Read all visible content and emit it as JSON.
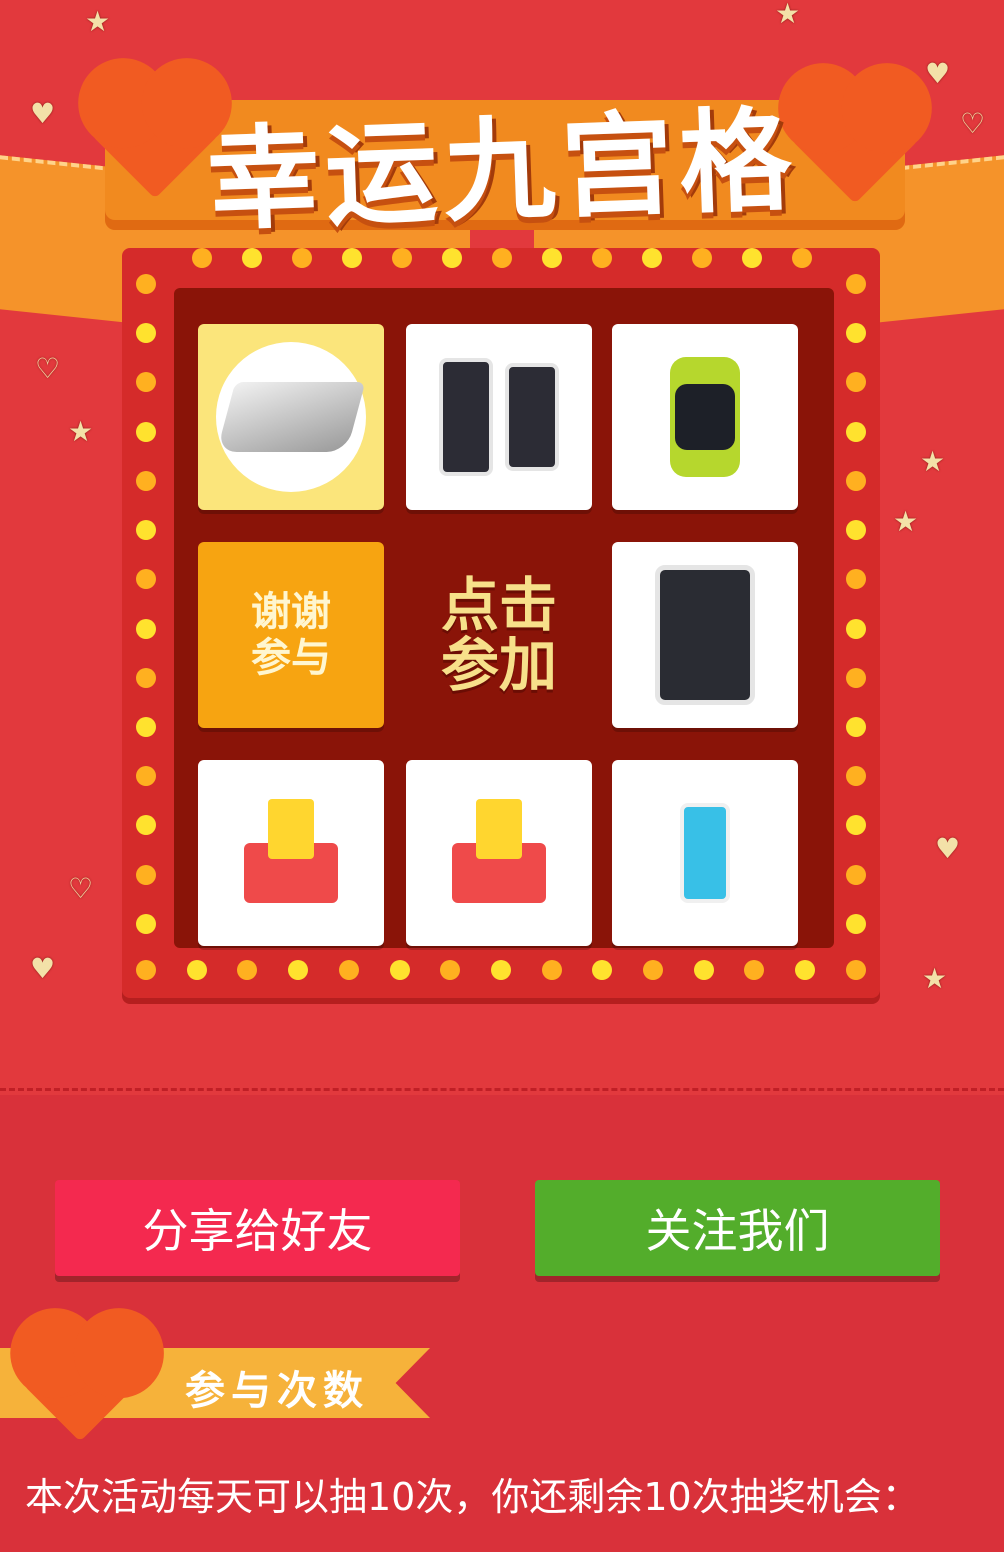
{
  "title": "幸运九宫格",
  "grid": {
    "thanks_label": "谢谢参与",
    "start_label": "点击参加",
    "prizes": [
      {
        "icon": "laptop-icon"
      },
      {
        "icon": "phone-icon"
      },
      {
        "icon": "watch-icon"
      },
      {
        "icon": "tablet-icon"
      },
      {
        "icon": "red-envelope-icon"
      },
      {
        "icon": "red-envelope-icon"
      },
      {
        "icon": "ipod-icon"
      }
    ]
  },
  "actions": {
    "share_label": "分享给好友",
    "follow_label": "关注我们"
  },
  "info": {
    "section_label": "参与次数",
    "text": "本次活动每天可以抽10次，你还剩余10次抽奖机会："
  },
  "colors": {
    "background": "#e2393d",
    "share_button": "#f4294f",
    "follow_button": "#53ad2b",
    "board_inner": "#8a1408"
  }
}
